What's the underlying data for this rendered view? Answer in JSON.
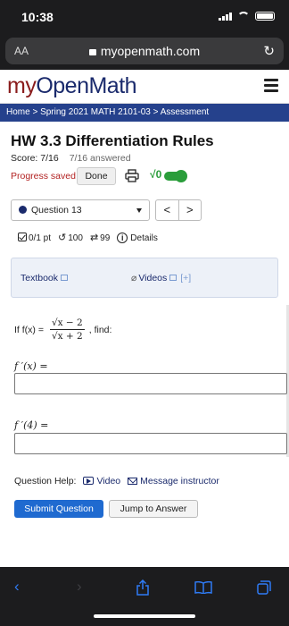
{
  "status_bar": {
    "time": "10:38"
  },
  "browser": {
    "aa_label": "AA",
    "url": "myopenmath.com"
  },
  "site": {
    "brand_prefix": "my",
    "brand_main": "OpenMath",
    "breadcrumb": "Home > Spring 2021 MATH 2101-03 > Assessment"
  },
  "assessment": {
    "title": "HW 3.3 Differentiation Rules",
    "score": "Score: 7/16",
    "answered": "7/16 answered",
    "progress_saved": "Progress saved",
    "done_label": "Done",
    "sqrt_label": "√0"
  },
  "question_nav": {
    "selected": "Question 13",
    "prev": "<",
    "next": ">"
  },
  "question_meta": {
    "points": "0/1 pt",
    "retries": "100",
    "attempts": "99",
    "details": "Details"
  },
  "resources": {
    "textbook": "Textbook",
    "videos": "Videos",
    "plus": "[+]"
  },
  "question": {
    "prefix": "If f(x) =",
    "numerator": "√x − 2",
    "denominator": "√x + 2",
    "suffix": ", find:",
    "part1_label": "f ′(x) =",
    "part2_label": "f ′(4) ="
  },
  "help": {
    "label": "Question Help:",
    "video": "Video",
    "message": "Message instructor"
  },
  "actions": {
    "submit": "Submit Question",
    "jump": "Jump to Answer"
  },
  "colors": {
    "brand_navy": "#1a2a6c",
    "crumb_blue": "#25418c",
    "submit_blue": "#1f6ad0",
    "saved_red": "#b22222",
    "toggle_green": "#2a9d3a"
  }
}
